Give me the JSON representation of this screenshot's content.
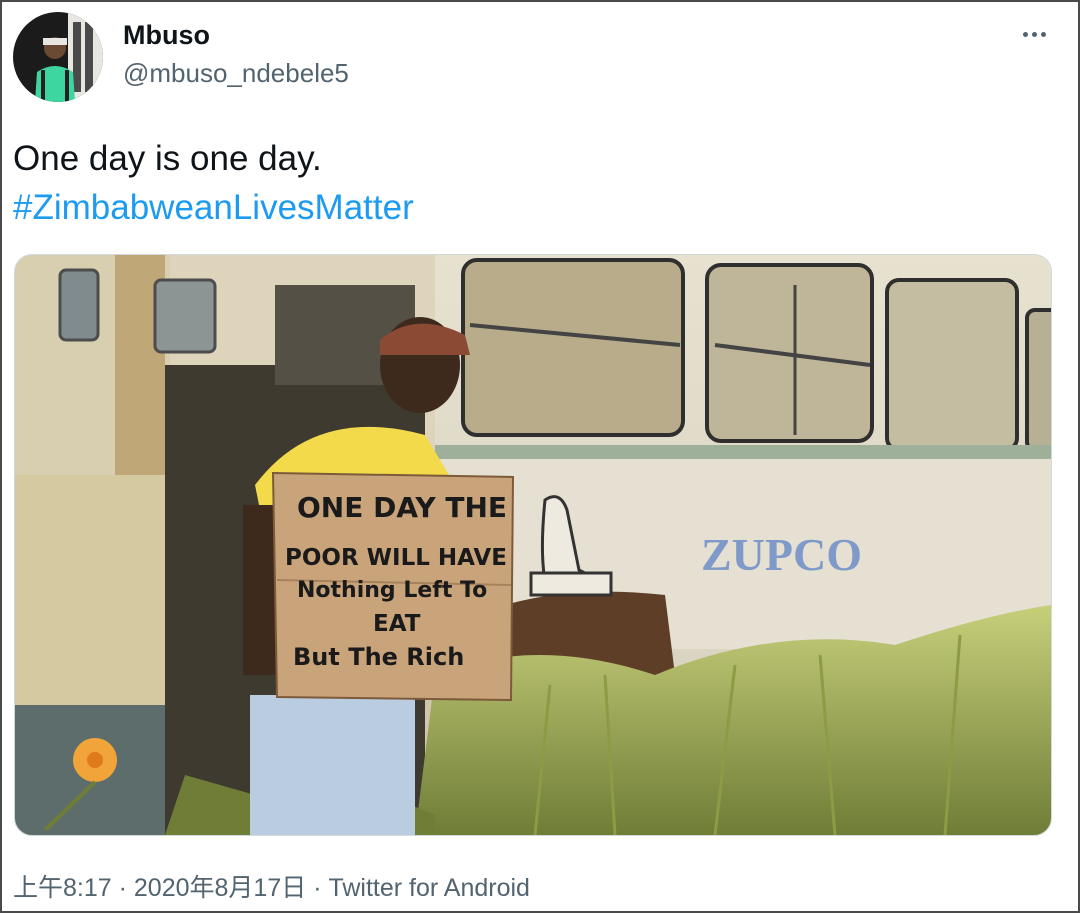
{
  "user": {
    "display_name": "Mbuso",
    "handle": "@mbuso_ndebele5"
  },
  "tweet": {
    "text": "One day is one day.",
    "hashtag": "#ZimbabweanLivesMatter"
  },
  "media": {
    "sign_lines": [
      "ONE DAY THE",
      "POOR WILL HAVE",
      "Nothing Left To",
      "EAT",
      "But The Rich"
    ],
    "bus_brand": "ZUPCO"
  },
  "meta": {
    "time": "上午8:17",
    "date": "2020年8月17日",
    "separator": "·",
    "source": "Twitter for Android"
  },
  "icons": {
    "more": "more-horizontal-icon"
  },
  "colors": {
    "hashtag": "#1d9bf0",
    "secondary_text": "#536471",
    "primary_text": "#0f1419"
  }
}
